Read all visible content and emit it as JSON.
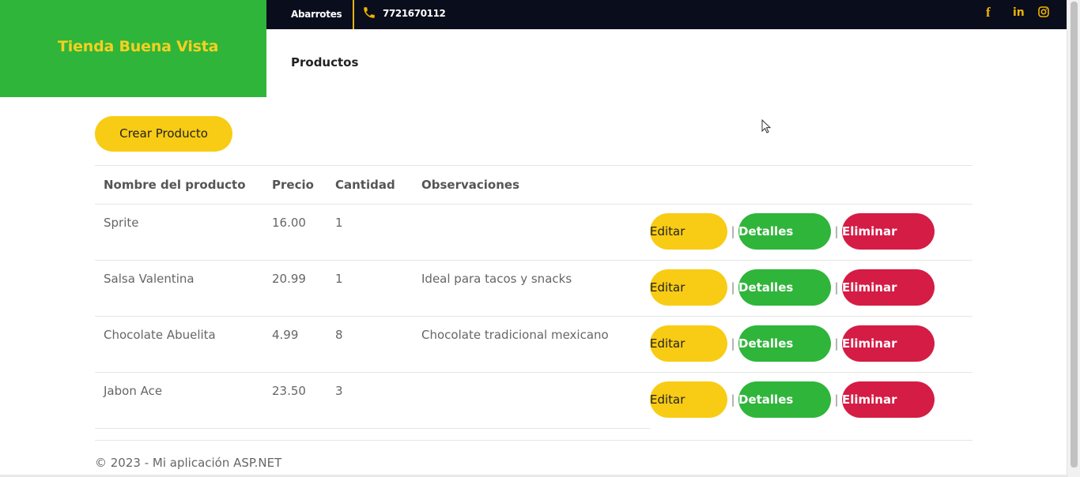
{
  "brand": {
    "name": "Tienda Buena Vista"
  },
  "topbar": {
    "store_type": "Abarrotes",
    "phone": "7721670112",
    "social": {
      "facebook": "f",
      "linkedin": "in"
    }
  },
  "nav": {
    "title": "Productos"
  },
  "create_button": {
    "label": "Crear Producto"
  },
  "table": {
    "headers": [
      "Nombre del producto",
      "Precio",
      "Cantidad",
      "Observaciones"
    ],
    "rows": [
      {
        "name": "Sprite",
        "price": "16.00",
        "qty": "1",
        "obs": ""
      },
      {
        "name": "Salsa Valentina",
        "price": "20.99",
        "qty": "1",
        "obs": "Ideal para tacos y snacks"
      },
      {
        "name": "Chocolate Abuelita",
        "price": "4.99",
        "qty": "8",
        "obs": "Chocolate tradicional mexicano"
      },
      {
        "name": "Jabon Ace",
        "price": "23.50",
        "qty": "3",
        "obs": ""
      }
    ],
    "actions": {
      "edit": "Editar",
      "details": "Detalles",
      "delete": "Eliminar",
      "separator": "|"
    }
  },
  "footer": {
    "text": "© 2023 - Mi aplicación ASP.NET"
  },
  "colors": {
    "brand_green": "#2fb53a",
    "accent_yellow": "#f8cc14",
    "danger_red": "#d41c45",
    "topbar_dark": "#0a0d1c"
  },
  "icons": {
    "phone": "phone-icon",
    "facebook": "facebook-icon",
    "linkedin": "linkedin-icon",
    "instagram": "instagram-icon"
  }
}
